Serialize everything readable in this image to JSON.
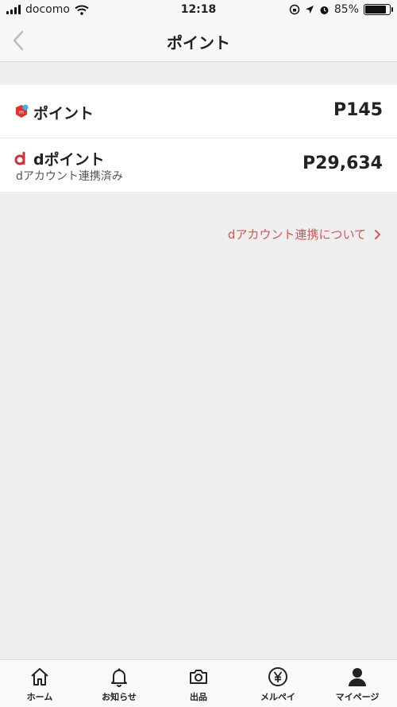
{
  "status_bar": {
    "carrier": "docomo",
    "time": "12:18",
    "battery": "85%",
    "battery_level": 0.85
  },
  "nav": {
    "title": "ポイント"
  },
  "points": {
    "mercari": {
      "label": "ポイント",
      "value": "P145",
      "icon": "mercari-icon"
    },
    "dpoint": {
      "label": "dポイント",
      "sub": "dアカウント連携済み",
      "value": "P29,634",
      "icon": "d-point-icon"
    }
  },
  "link": {
    "label": "dアカウント連携について"
  },
  "tabs": [
    {
      "label": "ホーム",
      "icon": "home-icon"
    },
    {
      "label": "お知らせ",
      "icon": "bell-icon"
    },
    {
      "label": "出品",
      "icon": "camera-icon"
    },
    {
      "label": "メルペイ",
      "icon": "yen-icon"
    },
    {
      "label": "マイページ",
      "icon": "person-icon"
    }
  ],
  "colors": {
    "accent_red": "#d9534f",
    "mercari_red": "#e0332f",
    "mercari_blue": "#3ab4e8"
  }
}
